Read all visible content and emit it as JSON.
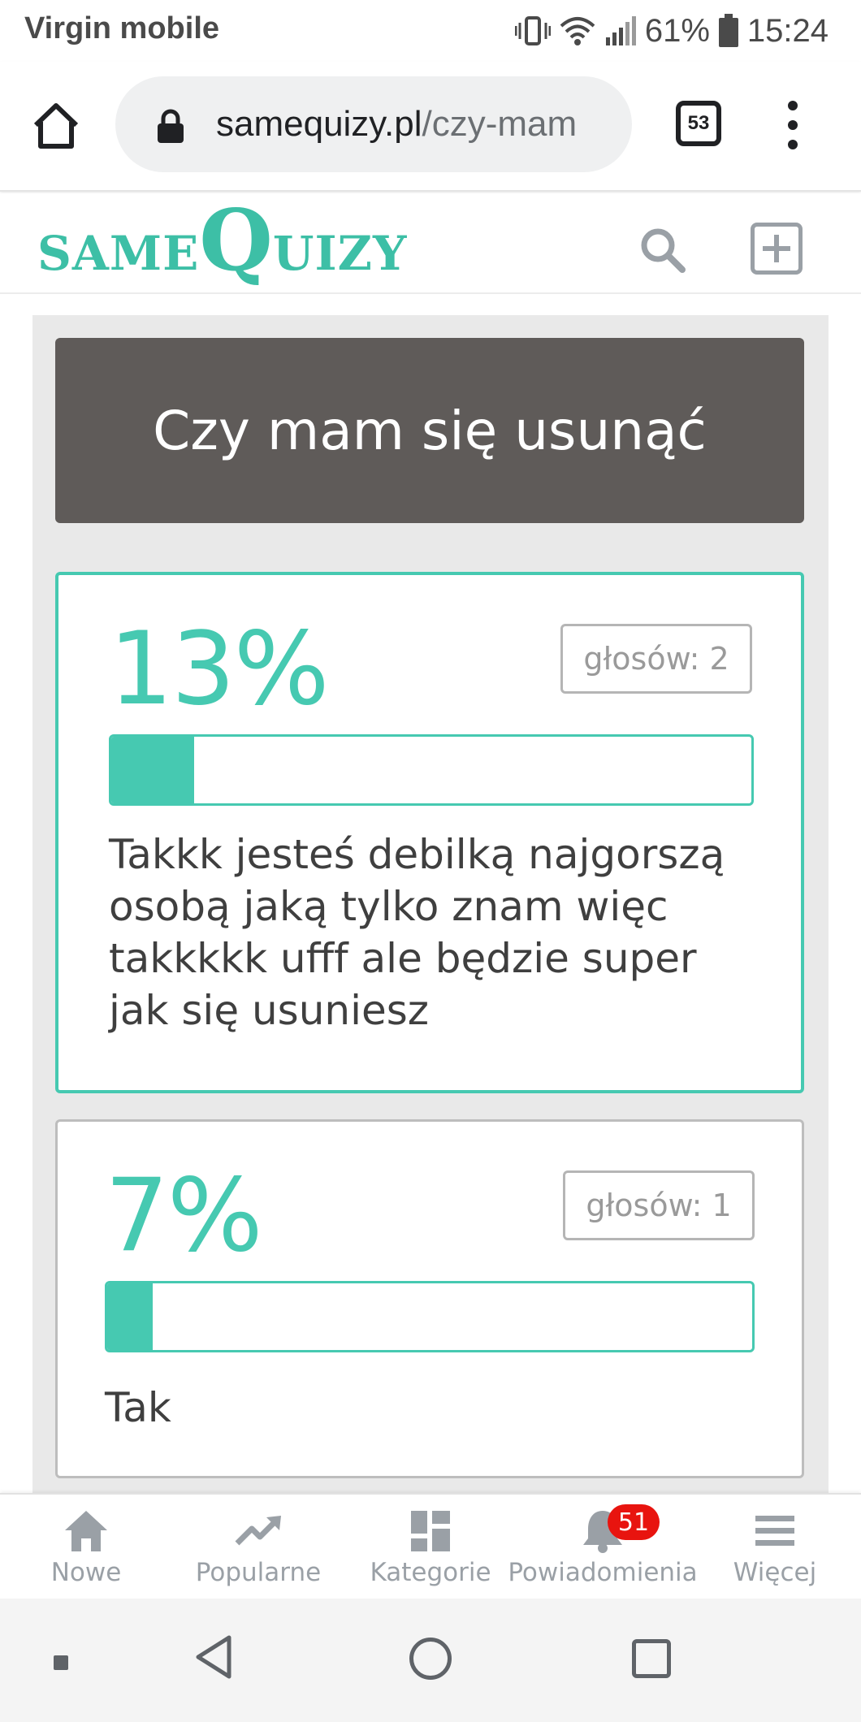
{
  "status_bar": {
    "carrier": "Virgin mobile",
    "battery": "61%",
    "time": "15:24"
  },
  "browser": {
    "url_host": "samequizy.pl",
    "url_path": "/czy-mam",
    "tab_count": "53"
  },
  "site": {
    "logo_same": "SAME",
    "logo_q": "Q",
    "logo_uizy": "UIZY",
    "brand_color": "#46c9b1"
  },
  "quiz": {
    "title": "Czy mam się usunąć",
    "answers": [
      {
        "percent_label": "13%",
        "percent": 13,
        "votes": "głosów: 2",
        "text": "Takkk jesteś debilką najgorszą osobą jaką tylko znam więc takkkkk ufff ale będzie super jak się usuniesz",
        "selected": true
      },
      {
        "percent_label": "7%",
        "percent": 7,
        "votes": "głosów: 1",
        "text": "Tak",
        "selected": false
      }
    ]
  },
  "bottom_nav": {
    "items": [
      {
        "label": "Nowe",
        "icon": "home-icon"
      },
      {
        "label": "Popularne",
        "icon": "trending-icon"
      },
      {
        "label": "Kategorie",
        "icon": "grid-icon"
      },
      {
        "label": "Powiadomienia",
        "icon": "bell-icon",
        "badge": "51"
      },
      {
        "label": "Więcej",
        "icon": "menu-icon"
      }
    ]
  }
}
